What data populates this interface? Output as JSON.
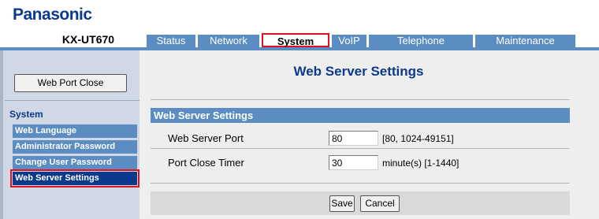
{
  "brand": "Panasonic",
  "model": "KX-UT670",
  "tabs": [
    {
      "label": "Status"
    },
    {
      "label": "Network"
    },
    {
      "label": "System"
    },
    {
      "label": "VoIP"
    },
    {
      "label": "Telephone"
    },
    {
      "label": "Maintenance"
    }
  ],
  "active_tab": "System",
  "sidebar": {
    "web_port_close_label": "Web Port Close",
    "heading": "System",
    "items": [
      {
        "label": "Web Language"
      },
      {
        "label": "Administrator Password"
      },
      {
        "label": "Change User Password"
      },
      {
        "label": "Web Server Settings"
      }
    ],
    "active_item": "Web Server Settings"
  },
  "main": {
    "title": "Web Server Settings",
    "panel_title": "Web Server Settings",
    "fields": [
      {
        "label": "Web Server Port",
        "value": "80",
        "hint": "[80, 1024-49151]"
      },
      {
        "label": "Port Close Timer",
        "value": "30",
        "hint": "minute(s) [1-1440]"
      }
    ],
    "save_label": "Save",
    "cancel_label": "Cancel"
  },
  "colors": {
    "brand_blue": "#0b3a8c",
    "tab_blue": "#5b8cc2",
    "highlight_red": "#e0121b"
  }
}
